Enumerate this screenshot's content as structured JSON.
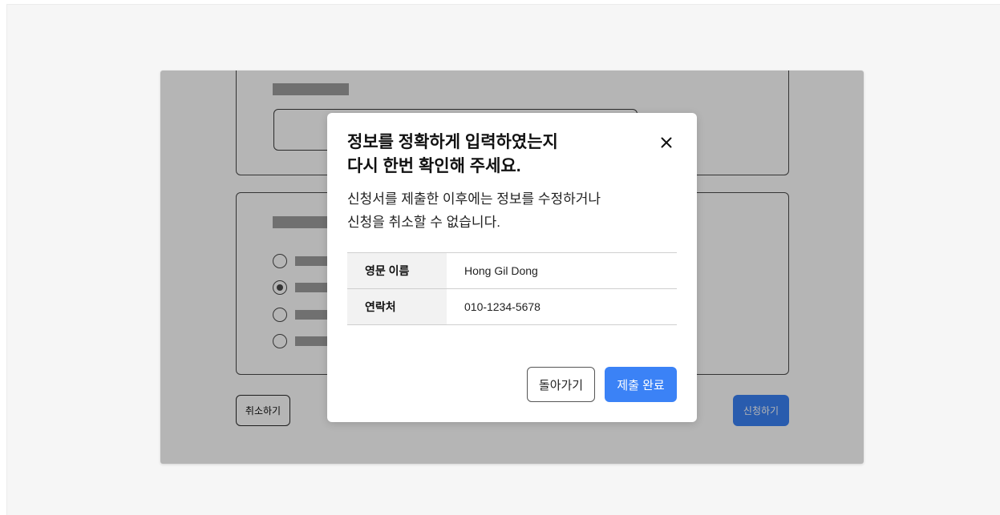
{
  "background_form": {
    "cancel_label": "취소하기",
    "apply_label": "신청하기",
    "radio_options": [
      {
        "checked": false
      },
      {
        "checked": true
      },
      {
        "checked": false
      },
      {
        "checked": false
      }
    ]
  },
  "modal": {
    "title_line1": "정보를 정확하게 입력하였는지",
    "title_line2": "다시 한번 확인해 주세요.",
    "desc_line1": "신청서를 제출한 이후에는 정보를 수정하거나",
    "desc_line2": "신청을 취소할 수 없습니다.",
    "close_icon": "close-icon",
    "rows": [
      {
        "label": "영문 이름",
        "value": "Hong Gil Dong"
      },
      {
        "label": "연락처",
        "value": "010-1234-5678"
      }
    ],
    "back_label": "돌아가기",
    "submit_label": "제출 완료"
  },
  "colors": {
    "primary": "#3b82f6",
    "overlay": "rgba(0,0,0,0.29)"
  }
}
